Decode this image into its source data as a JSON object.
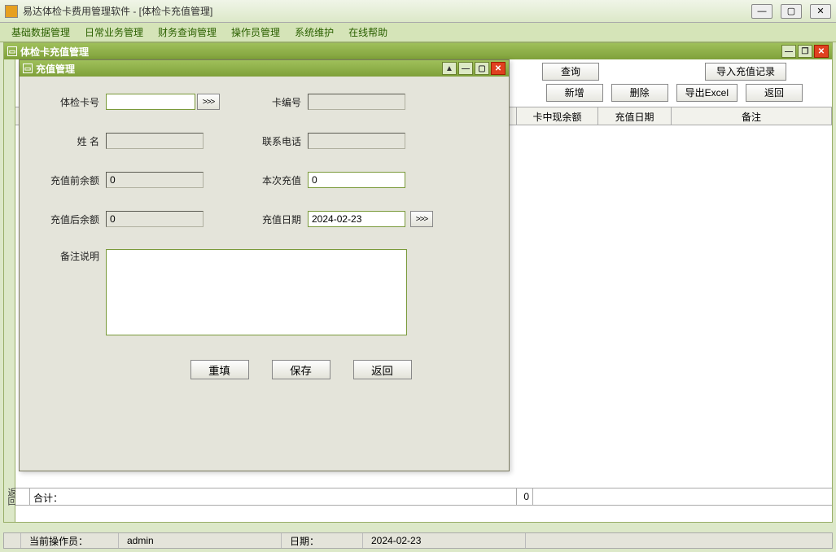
{
  "app": {
    "title": "易达体检卡费用管理软件   - [体检卡充值管理]"
  },
  "menu": [
    "基础数据管理",
    "日常业务管理",
    "财务查询管理",
    "操作员管理",
    "系统维护",
    "在线帮助"
  ],
  "bg_window": {
    "title": "体检卡充值管理",
    "toolbar": {
      "query": "查询",
      "import_record": "导入充值记录",
      "add": "新增",
      "delete": "删除",
      "export_excel": "导出Excel",
      "return": "返回"
    },
    "table_headers": [
      "卡中现余额",
      "充值日期",
      "备注"
    ],
    "footer": {
      "label": "合计：",
      "sum": "0"
    }
  },
  "dialog": {
    "title": "充值管理",
    "labels": {
      "card_no": "体检卡号",
      "card_code": "卡编号",
      "name": "姓    名",
      "phone": "联系电话",
      "balance_before": "充值前余额",
      "this_recharge": "本次充值",
      "balance_after": "充值后余额",
      "date": "充值日期",
      "remark": "备注说明"
    },
    "values": {
      "card_no": "",
      "card_code": "",
      "name": "",
      "phone": "",
      "balance_before": "0",
      "this_recharge": "0",
      "balance_after": "0",
      "date": "2024-02-23",
      "remark": ""
    },
    "browse": ">>>",
    "buttons": {
      "reset": "重填",
      "save": "保存",
      "return": "返回"
    }
  },
  "status": {
    "operator_label": "当前操作员：",
    "operator": "admin",
    "date_label": "日期：",
    "date": "2024-02-23"
  },
  "left_stub": "返回"
}
